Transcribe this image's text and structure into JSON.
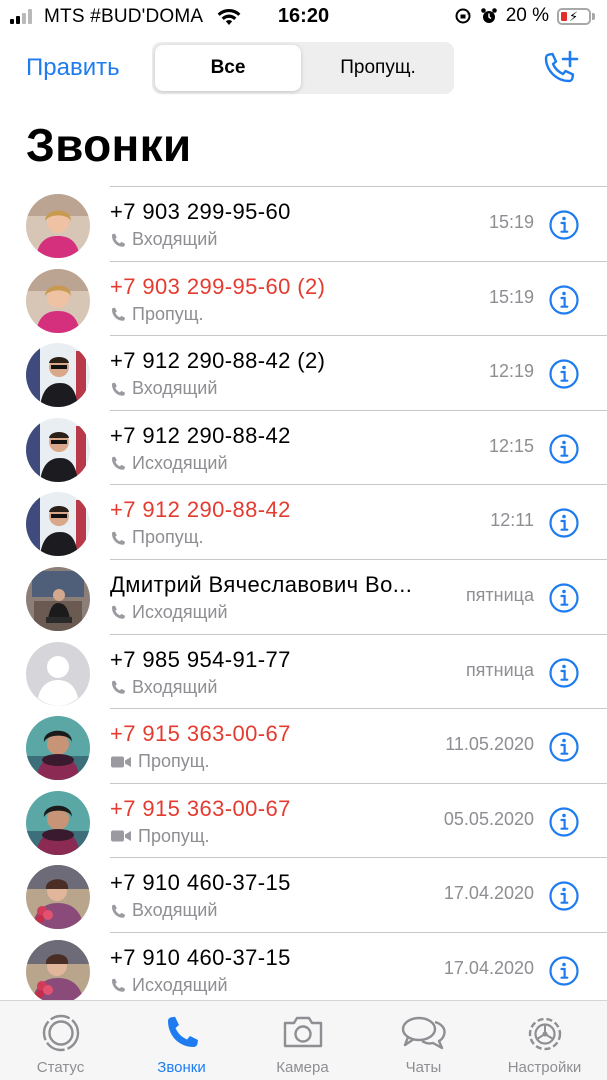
{
  "status_bar": {
    "carrier": "MTS #BUD'DOMA",
    "time": "16:20",
    "battery": "20 %"
  },
  "nav": {
    "edit_label": "Править",
    "segments": [
      "Все",
      "Пропущ."
    ],
    "selected_segment": "Все"
  },
  "page_title": "Звонки",
  "colors": {
    "accent": "#1e7cf0",
    "missed": "#e43b30",
    "secondary_text": "#8e8e93"
  },
  "calls": [
    {
      "name": "+7 903 299-95-60",
      "type": "Входящий",
      "time": "15:19",
      "missed": false,
      "icon": "phone-icon"
    },
    {
      "name": "+7 903 299-95-60  (2)",
      "type": "Пропущ.",
      "time": "15:19",
      "missed": true,
      "icon": "phone-icon"
    },
    {
      "name": "+7 912 290-88-42  (2)",
      "type": "Входящий",
      "time": "12:19",
      "missed": false,
      "icon": "phone-icon"
    },
    {
      "name": "+7 912 290-88-42",
      "type": "Исходящий",
      "time": "12:15",
      "missed": false,
      "icon": "phone-icon"
    },
    {
      "name": "+7 912 290-88-42",
      "type": "Пропущ.",
      "time": "12:11",
      "missed": true,
      "icon": "phone-icon"
    },
    {
      "name": "Дмитрий Вячеславович Во...",
      "type": "Исходящий",
      "time": "пятница",
      "missed": false,
      "icon": "phone-icon"
    },
    {
      "name": "+7 985 954-91-77",
      "type": "Входящий",
      "time": "пятница",
      "missed": false,
      "icon": "phone-icon"
    },
    {
      "name": "+7 915 363-00-67",
      "type": "Пропущ.",
      "time": "11.05.2020",
      "missed": true,
      "icon": "video-icon"
    },
    {
      "name": "+7 915 363-00-67",
      "type": "Пропущ.",
      "time": "05.05.2020",
      "missed": true,
      "icon": "video-icon"
    },
    {
      "name": "+7 910 460-37-15",
      "type": "Входящий",
      "time": "17.04.2020",
      "missed": false,
      "icon": "phone-icon"
    },
    {
      "name": "+7 910 460-37-15",
      "type": "Исходящий",
      "time": "17.04.2020",
      "missed": false,
      "icon": "phone-icon"
    }
  ],
  "tabs": [
    {
      "label": "Статус",
      "icon": "status-icon"
    },
    {
      "label": "Звонки",
      "icon": "phone-tab-icon"
    },
    {
      "label": "Камера",
      "icon": "camera-icon"
    },
    {
      "label": "Чаты",
      "icon": "chats-icon"
    },
    {
      "label": "Настройки",
      "icon": "settings-icon"
    }
  ],
  "active_tab": "Звонки"
}
